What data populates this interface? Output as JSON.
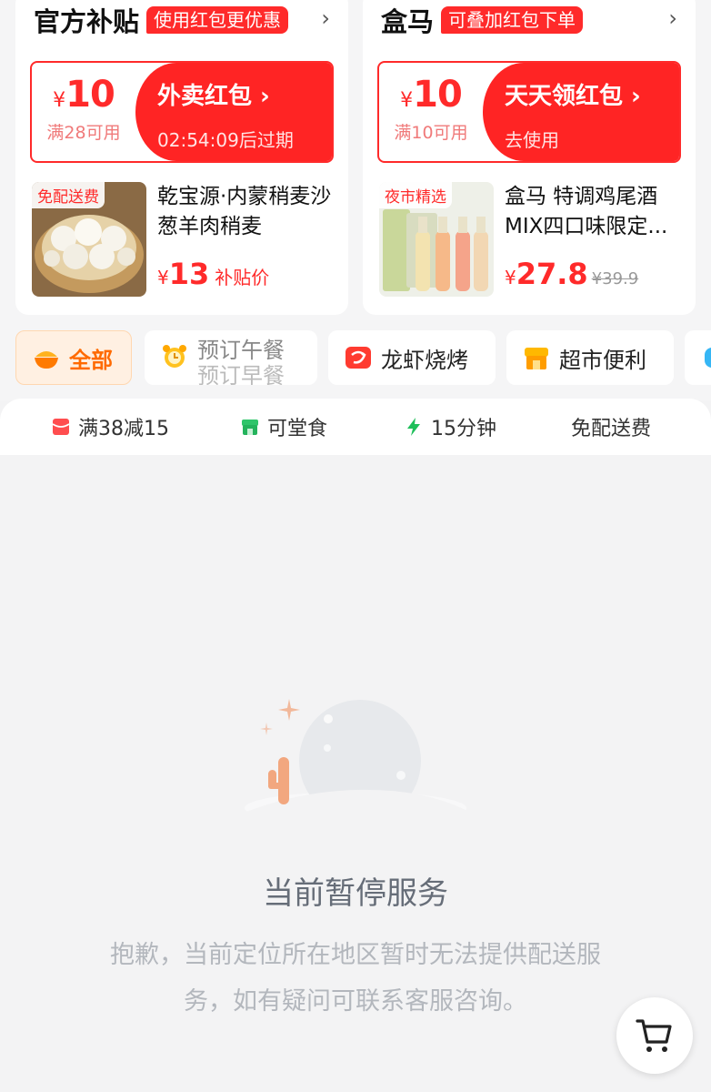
{
  "subsidy_card": {
    "title": "官方补贴",
    "tag": "使用红包更优惠",
    "coupon": {
      "currency": "¥",
      "amount": "10",
      "condition": "满28可用",
      "name": "外卖红包 ›",
      "sub": "02:54:09后过期"
    },
    "product": {
      "badge": "免配送费",
      "name": "乾宝源·内蒙稍麦沙葱羊肉稍麦",
      "currency": "¥",
      "price": "13",
      "price_tag": "补贴价"
    }
  },
  "hema_card": {
    "title": "盒马",
    "tag": "可叠加红包下单",
    "coupon": {
      "currency": "¥",
      "amount": "10",
      "condition": "满10可用",
      "name": "天天领红包 ›",
      "sub": "去使用"
    },
    "product": {
      "badge": "夜市精选",
      "name": "盒马 特调鸡尾酒MIX四口味限定...",
      "currency": "¥",
      "price": "27.8",
      "old_price": "¥39.9"
    }
  },
  "categories": [
    {
      "label": "全部",
      "icon": "bowl-icon",
      "active": true
    },
    {
      "label": "预订午餐",
      "label2": "预订早餐",
      "icon": "alarm-clock-icon"
    },
    {
      "label": "龙虾烧烤",
      "icon": "lobster-icon"
    },
    {
      "label": "超市便利",
      "icon": "store-icon"
    }
  ],
  "filters": [
    {
      "label": "满38减15",
      "icon": "red-packet-icon"
    },
    {
      "label": "可堂食",
      "icon": "shop-icon"
    },
    {
      "label": "15分钟",
      "icon": "lightning-icon"
    },
    {
      "label": "免配送费"
    }
  ],
  "empty_state": {
    "title": "当前暂停服务",
    "description": "抱歉，当前定位所在地区暂时无法提供配送服务，如有疑问可联系客服咨询。"
  },
  "colors": {
    "accent_red": "#ff2a2a",
    "active_orange": "#ff6a00",
    "background": "#f3f3f4"
  },
  "cart_button": {
    "icon": "shopping-cart-icon"
  }
}
